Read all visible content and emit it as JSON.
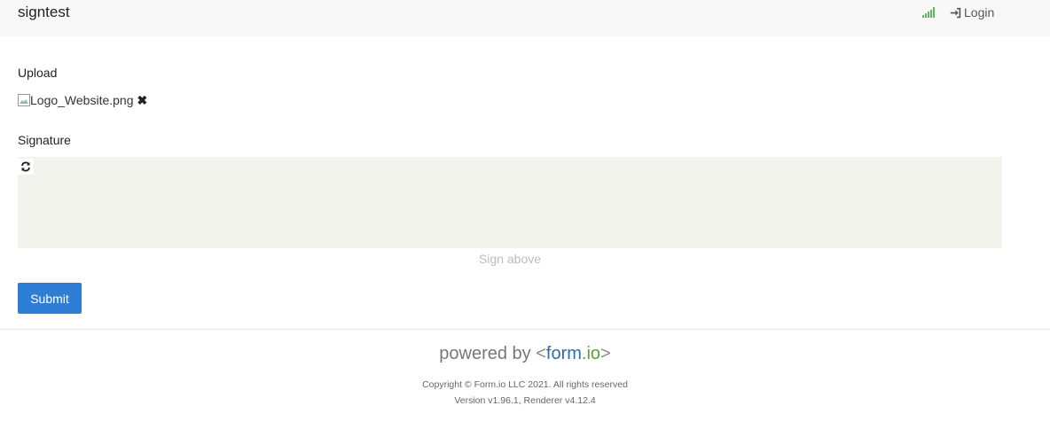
{
  "header": {
    "brand": "signtest",
    "login_label": "Login",
    "signal_color": "#5cb85c"
  },
  "form": {
    "upload_label": "Upload",
    "file_name": "Logo_Website.png",
    "signature_label": "Signature",
    "signature_hint": "Sign above",
    "submit_label": "Submit",
    "accent_color": "#2e7ed6"
  },
  "footer": {
    "powered_prefix": "powered by",
    "powered_brand_lt": "<",
    "powered_brand_form": "form",
    "powered_brand_io": ".io",
    "powered_brand_gt": ">",
    "copyright": "Copyright © Form.io LLC 2021. All rights reserved",
    "version": "Version v1.96.1, Renderer v4.12.4"
  },
  "icons": {
    "signal": "signal-icon",
    "login": "sign-in-icon",
    "broken_image": "broken-image-icon",
    "remove": "remove-icon",
    "refresh": "refresh-icon"
  }
}
